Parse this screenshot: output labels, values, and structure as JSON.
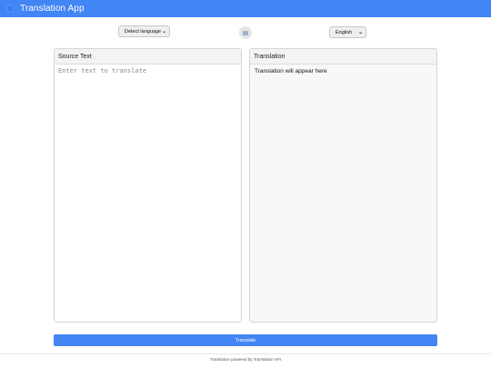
{
  "header": {
    "title": "Translation App",
    "logo_icon": "globe-icon",
    "background_color": "#4285f4"
  },
  "language_bar": {
    "source_language": "Detect language",
    "target_language": "English",
    "swap_icon": "swap-languages-icon"
  },
  "source_panel": {
    "title": "Source Text",
    "placeholder": "Enter text to translate",
    "value": ""
  },
  "translation_panel": {
    "title": "Translation",
    "output": "Translation will appear here"
  },
  "actions": {
    "translate_label": "Translate"
  },
  "footer": {
    "text": "Translation powered by Translation API"
  }
}
